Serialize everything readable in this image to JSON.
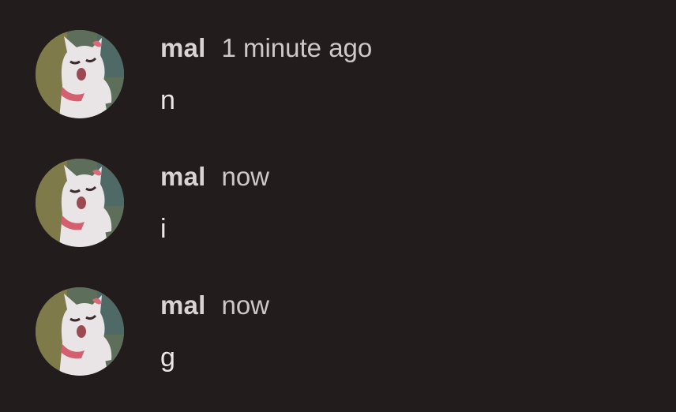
{
  "comments": [
    {
      "author": "mal",
      "time": "1 minute ago",
      "text": "n",
      "avatar_icon": "cat-avatar-icon"
    },
    {
      "author": "mal",
      "time": "now",
      "text": "i",
      "avatar_icon": "cat-avatar-icon"
    },
    {
      "author": "mal",
      "time": "now",
      "text": "g",
      "avatar_icon": "cat-avatar-icon"
    }
  ],
  "colors": {
    "background": "#231c1c",
    "author": "#d9d3d3",
    "time": "#cfc8c8",
    "text": "#ece7e7"
  }
}
